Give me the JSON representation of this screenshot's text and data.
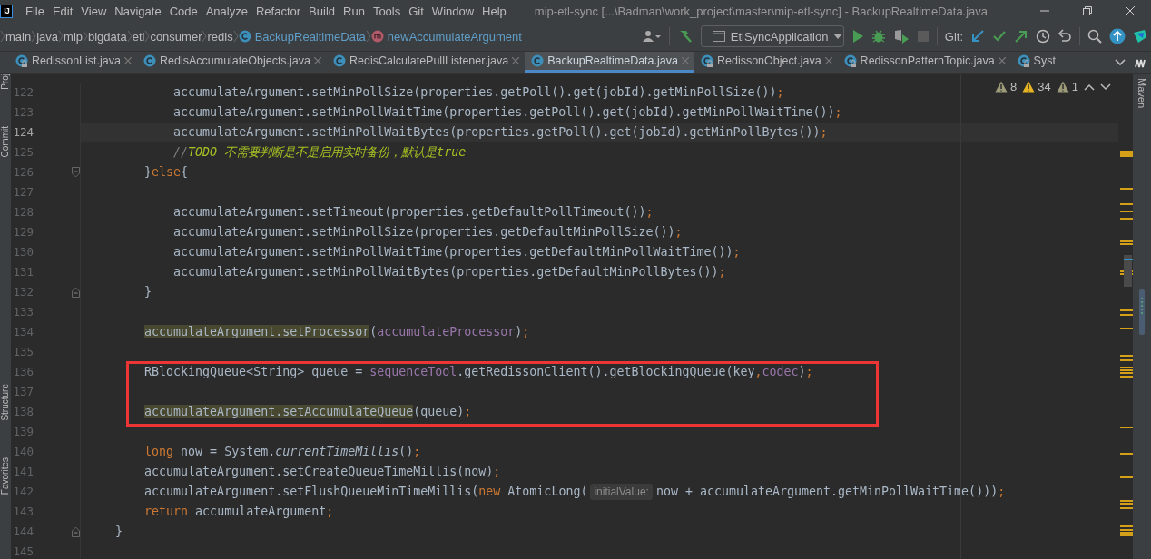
{
  "app_logo": "IJ",
  "menu": [
    "File",
    "Edit",
    "View",
    "Navigate",
    "Code",
    "Analyze",
    "Refactor",
    "Build",
    "Run",
    "Tools",
    "Git",
    "Window",
    "Help"
  ],
  "window_title": "mip-etl-sync [...\\Badman\\work_project\\master\\mip-etl-sync] - BackupRealtimeData.java",
  "breadcrumbs": [
    {
      "label": "main",
      "kind": "folder"
    },
    {
      "label": "java",
      "kind": "folder"
    },
    {
      "label": "mip",
      "kind": "folder"
    },
    {
      "label": "bigdata",
      "kind": "folder"
    },
    {
      "label": "etl",
      "kind": "folder"
    },
    {
      "label": "consumer",
      "kind": "folder"
    },
    {
      "label": "redis",
      "kind": "folder"
    },
    {
      "label": "BackupRealtimeData",
      "kind": "class"
    },
    {
      "label": "newAccumulateArgument",
      "kind": "method"
    }
  ],
  "toolbar": {
    "run_configuration": "EtlSyncApplication",
    "git_label": "Git:"
  },
  "tabs": [
    {
      "label": "RedissonList.java",
      "selected": false,
      "locked": true,
      "closable": true
    },
    {
      "label": "RedisAccumulateObjects.java",
      "selected": false,
      "locked": false,
      "closable": true
    },
    {
      "label": "RedisCalculatePullListener.java",
      "selected": false,
      "locked": false,
      "closable": true
    },
    {
      "label": "BackupRealtimeData.java",
      "selected": true,
      "locked": false,
      "closable": true
    },
    {
      "label": "RedissonObject.java",
      "selected": false,
      "locked": true,
      "closable": true
    },
    {
      "label": "RedissonPatternTopic.java",
      "selected": false,
      "locked": true,
      "closable": true
    },
    {
      "label": "Syst",
      "selected": false,
      "locked": true,
      "closable": false
    }
  ],
  "left_tool_windows": [
    "Proj",
    "Commit",
    "Structure",
    "Favorites"
  ],
  "right_tool_windows": [
    "Maven"
  ],
  "inspections": [
    {
      "kind": "weak_warning",
      "count": "8"
    },
    {
      "kind": "warning",
      "count": "34"
    },
    {
      "kind": "typo",
      "count": "1"
    }
  ],
  "editor": {
    "lines": [
      {
        "kind": "line",
        "number": "122",
        "current": false,
        "tokens": [
          {
            "text": "            accumulateArgument.setMinPollSize(properties.getPoll().get(jobId).getMinPollSize())",
            "kind": "plain"
          },
          {
            "text": ";",
            "kind": "punct"
          }
        ]
      },
      {
        "kind": "line",
        "number": "123",
        "current": false,
        "tokens": [
          {
            "text": "            accumulateArgument.setMinPollWaitTime(properties.getPoll().get(jobId).getMinPollWaitTime())",
            "kind": "plain"
          },
          {
            "text": ";",
            "kind": "punct"
          }
        ]
      },
      {
        "kind": "line",
        "number": "124",
        "current": true,
        "tokens": [
          {
            "text": "            accumulateArgument.setMinPollWaitBytes(properties.getPoll().get(jobId).getMinPollBytes())",
            "kind": "plain"
          },
          {
            "text": ";",
            "kind": "punct"
          }
        ]
      },
      {
        "kind": "line",
        "number": "125",
        "current": false,
        "tokens": [
          {
            "text": "            //",
            "kind": "comment"
          },
          {
            "text": "TODO 不需要判断是不是启用实时备份，默认是true",
            "kind": "todo"
          }
        ]
      },
      {
        "kind": "line",
        "number": "126",
        "current": false,
        "fold": {
          "kind": "start"
        },
        "tokens": [
          {
            "text": "        }",
            "kind": "plain"
          },
          {
            "text": "else",
            "kind": "keyword"
          },
          {
            "text": "{",
            "kind": "plain"
          }
        ]
      },
      {
        "kind": "line",
        "number": "127",
        "current": false
      },
      {
        "kind": "line",
        "number": "128",
        "current": false,
        "tokens": [
          {
            "text": "            accumulateArgument.setTimeout(properties.getDefaultPollTimeout())",
            "kind": "plain"
          },
          {
            "text": ";",
            "kind": "punct"
          }
        ]
      },
      {
        "kind": "line",
        "number": "129",
        "current": false,
        "tokens": [
          {
            "text": "            accumulateArgument.setMinPollSize(properties.getDefaultMinPollSize())",
            "kind": "plain"
          },
          {
            "text": ";",
            "kind": "punct"
          }
        ]
      },
      {
        "kind": "line",
        "number": "130",
        "current": false,
        "tokens": [
          {
            "text": "            accumulateArgument.setMinPollWaitTime(properties.getDefaultMinPollWaitTime())",
            "kind": "plain"
          },
          {
            "text": ";",
            "kind": "punct"
          }
        ]
      },
      {
        "kind": "line",
        "number": "131",
        "current": false,
        "tokens": [
          {
            "text": "            accumulateArgument.setMinPollWaitBytes(properties.getDefaultMinPollBytes())",
            "kind": "plain"
          },
          {
            "text": ";",
            "kind": "punct"
          }
        ]
      },
      {
        "kind": "line",
        "number": "132",
        "current": false,
        "fold": {
          "kind": "end"
        },
        "tokens": [
          {
            "text": "        }",
            "kind": "plain"
          }
        ]
      },
      {
        "kind": "line",
        "number": "133",
        "current": false
      },
      {
        "kind": "line",
        "number": "134",
        "current": false,
        "tokens": [
          {
            "text": "        accumulateArgument.setProcessor",
            "kind": "usage"
          },
          {
            "text": "(",
            "kind": "plain"
          },
          {
            "text": "accumulateProcessor",
            "kind": "field"
          },
          {
            "text": ")",
            "kind": "plain"
          },
          {
            "text": ";",
            "kind": "punct"
          }
        ]
      },
      {
        "kind": "line",
        "number": "135",
        "current": false
      },
      {
        "kind": "annotation_box",
        "lines": [
          {
            "kind": "line",
            "number": "136",
            "current": false,
            "tokens": [
              {
                "text": "        RBlockingQueue<String> queue = ",
                "kind": "plain"
              },
              {
                "text": "sequenceTool",
                "kind": "field"
              },
              {
                "text": ".getRedissonClient().getBlockingQueue(key",
                "kind": "plain"
              },
              {
                "text": ",",
                "kind": "punct"
              },
              {
                "text": "codec",
                "kind": "field"
              },
              {
                "text": ")",
                "kind": "plain"
              },
              {
                "text": ";",
                "kind": "punct"
              }
            ]
          },
          {
            "kind": "line",
            "number": "137",
            "current": false
          },
          {
            "kind": "line",
            "number": "138",
            "current": false,
            "tokens": [
              {
                "text": "        accumulateArgument.setAccumulateQueue",
                "kind": "usage"
              },
              {
                "text": "(queue)",
                "kind": "plain"
              },
              {
                "text": ";",
                "kind": "punct"
              }
            ]
          }
        ]
      },
      {
        "kind": "line",
        "number": "139",
        "current": false
      },
      {
        "kind": "line",
        "number": "140",
        "current": false,
        "tokens": [
          {
            "text": "        long",
            "kind": "keyword"
          },
          {
            "text": " now = System.",
            "kind": "plain"
          },
          {
            "text": "currentTimeMillis",
            "kind": "static"
          },
          {
            "text": "()",
            "kind": "plain"
          },
          {
            "text": ";",
            "kind": "punct"
          }
        ]
      },
      {
        "kind": "line",
        "number": "141",
        "current": false,
        "tokens": [
          {
            "text": "        accumulateArgument.setCreateQueueTimeMillis(now)",
            "kind": "plain"
          },
          {
            "text": ";",
            "kind": "punct"
          }
        ]
      },
      {
        "kind": "line",
        "number": "142",
        "current": false,
        "tokens": [
          {
            "text": "        accumulateArgument.setFlushQueueMinTimeMillis(",
            "kind": "plain"
          },
          {
            "text": "new",
            "kind": "keyword"
          },
          {
            "text": " AtomicLong(",
            "kind": "plain"
          },
          {
            "text": "initialValue:",
            "kind": "hint"
          },
          {
            "text": "now + accumulateArgument.getMinPollWaitTime()))",
            "kind": "plain"
          },
          {
            "text": ";",
            "kind": "punct"
          }
        ]
      },
      {
        "kind": "line",
        "number": "143",
        "current": false,
        "tokens": [
          {
            "text": "        return",
            "kind": "keyword"
          },
          {
            "text": " accumulateArgument",
            "kind": "plain"
          },
          {
            "text": ";",
            "kind": "punct"
          }
        ]
      },
      {
        "kind": "line",
        "number": "144",
        "current": false,
        "fold": {
          "kind": "end"
        },
        "tokens": [
          {
            "text": "    }",
            "kind": "plain"
          }
        ]
      },
      {
        "kind": "line",
        "number": "145",
        "current": false
      }
    ]
  }
}
